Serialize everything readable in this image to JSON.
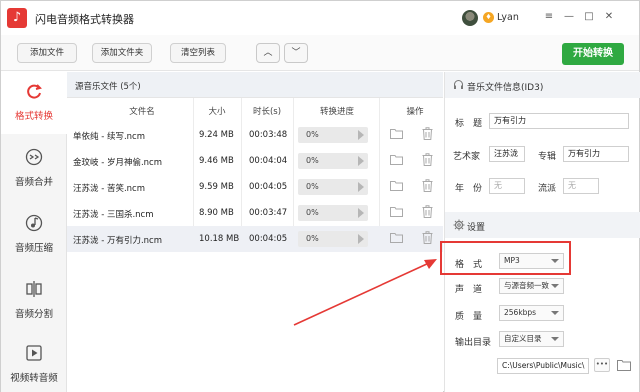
{
  "app": {
    "title": "闪电音频格式转换器",
    "logo_glyph": "♪"
  },
  "user": {
    "name": "Lyan",
    "vip_glyph": "♦"
  },
  "window_controls": [
    "≡",
    "—",
    "□",
    "✕"
  ],
  "toolbar": {
    "add_file": "添加文件",
    "add_folder": "添加文件夹",
    "clear_list": "清空列表",
    "move_up": "︿",
    "move_down": "﹀",
    "start": "开始转换"
  },
  "sidebar": {
    "items": [
      {
        "label": "格式转换",
        "icon": "convert-icon",
        "active": true
      },
      {
        "label": "音频合并",
        "icon": "merge-icon",
        "active": false
      },
      {
        "label": "音频压缩",
        "icon": "compress-icon",
        "active": false
      },
      {
        "label": "音频分割",
        "icon": "split-icon",
        "active": false
      },
      {
        "label": "视频转音频",
        "icon": "video-to-audio-icon",
        "active": false
      }
    ]
  },
  "file_list": {
    "title": "源音乐文件 (5个)",
    "columns": [
      "文件名",
      "大小",
      "时长(s)",
      "转换进度",
      "操作"
    ],
    "rows": [
      {
        "name": "单依纯 - 续写.ncm",
        "size": "9.24 MB",
        "duration": "00:03:48",
        "progress": "0%"
      },
      {
        "name": "金玟岐 - 岁月神偷.ncm",
        "size": "9.46 MB",
        "duration": "00:04:04",
        "progress": "0%"
      },
      {
        "name": "汪苏泷 - 苦笑.ncm",
        "size": "9.59 MB",
        "duration": "00:04:05",
        "progress": "0%"
      },
      {
        "name": "汪苏泷 - 三国杀.ncm",
        "size": "8.90 MB",
        "duration": "00:03:47",
        "progress": "0%"
      },
      {
        "name": "汪苏泷 - 万有引力.ncm",
        "size": "10.18 MB",
        "duration": "00:04:05",
        "progress": "0%"
      }
    ],
    "selected_row": 4
  },
  "id3": {
    "title": "音乐文件信息(ID3)",
    "title_label": "标　题",
    "title_value": "万有引力",
    "artist_label": "艺术家",
    "artist_value": "汪苏泷",
    "album_label": "专辑",
    "album_value": "万有引力",
    "year_label": "年　份",
    "year_placeholder": "无",
    "genre_label": "流派",
    "genre_placeholder": "无"
  },
  "settings": {
    "title": "设置",
    "format_label": "格　式",
    "format_value": "MP3",
    "channel_label": "声　道",
    "channel_value": "与源音频一致",
    "quality_label": "质　量",
    "quality_value": "256kbps",
    "output_label": "输出目录",
    "output_mode": "自定义目录",
    "output_path": "C:\\Users\\Public\\Music\\",
    "browse_dots": "•••"
  },
  "colors": {
    "accent_red": "#e53935",
    "start_green": "#2fa941"
  }
}
